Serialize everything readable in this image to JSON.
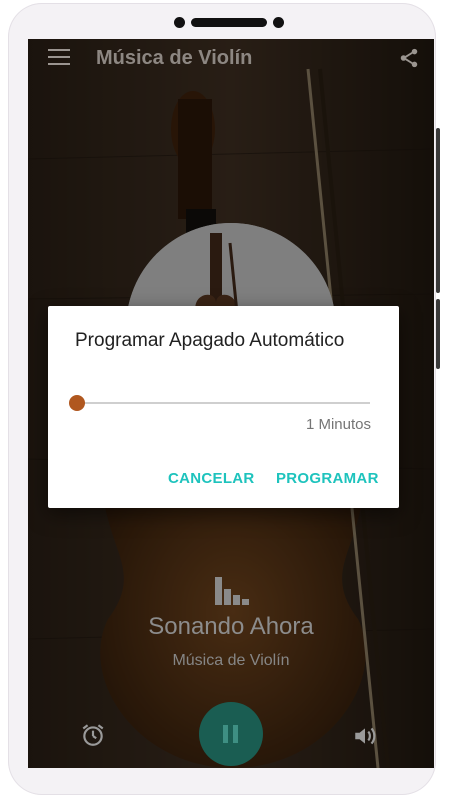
{
  "app": {
    "title": "Música de Violín"
  },
  "player": {
    "now_playing": "Sonando Ahora",
    "station": "Música de Violín",
    "state_icon": "pause-icon"
  },
  "dialog": {
    "title": "Programar Apagado Automático",
    "slider_value": 1,
    "slider_label": "1 Minutos",
    "cancel_label": "CANCELAR",
    "confirm_label": "PROGRAMAR"
  },
  "icons": {
    "menu": "menu-icon",
    "share": "share-icon",
    "equalizer": "equalizer-icon",
    "alarm": "alarm-icon",
    "volume": "volume-icon"
  },
  "colors": {
    "accent": "#1ec3bd",
    "slider_thumb": "#b0571f",
    "play_button": "#1a5d52"
  }
}
